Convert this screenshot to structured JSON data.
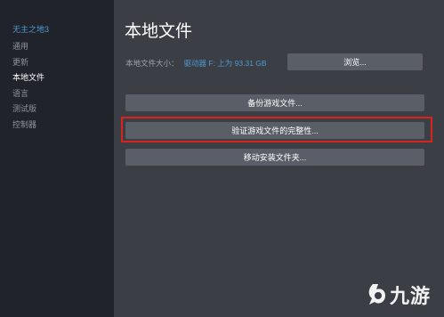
{
  "sidebar": {
    "game_title": "无主之地3",
    "items": [
      {
        "label": "通用"
      },
      {
        "label": "更新"
      },
      {
        "label": "本地文件"
      },
      {
        "label": "语言"
      },
      {
        "label": "测试版"
      },
      {
        "label": "控制器"
      }
    ],
    "active_index": 2
  },
  "main": {
    "title": "本地文件",
    "size_label": "本地文件大小：",
    "size_value": "驱动器 F: 上为 93.31 GB",
    "browse_label": "浏览...",
    "backup_label": "备份游戏文件...",
    "verify_label": "验证游戏文件的完整性...",
    "move_label": "移动安装文件夹..."
  },
  "highlight_color": "#d9241b",
  "watermark": {
    "logo_icon": "jiuyou-logo-icon",
    "text": "九游"
  }
}
